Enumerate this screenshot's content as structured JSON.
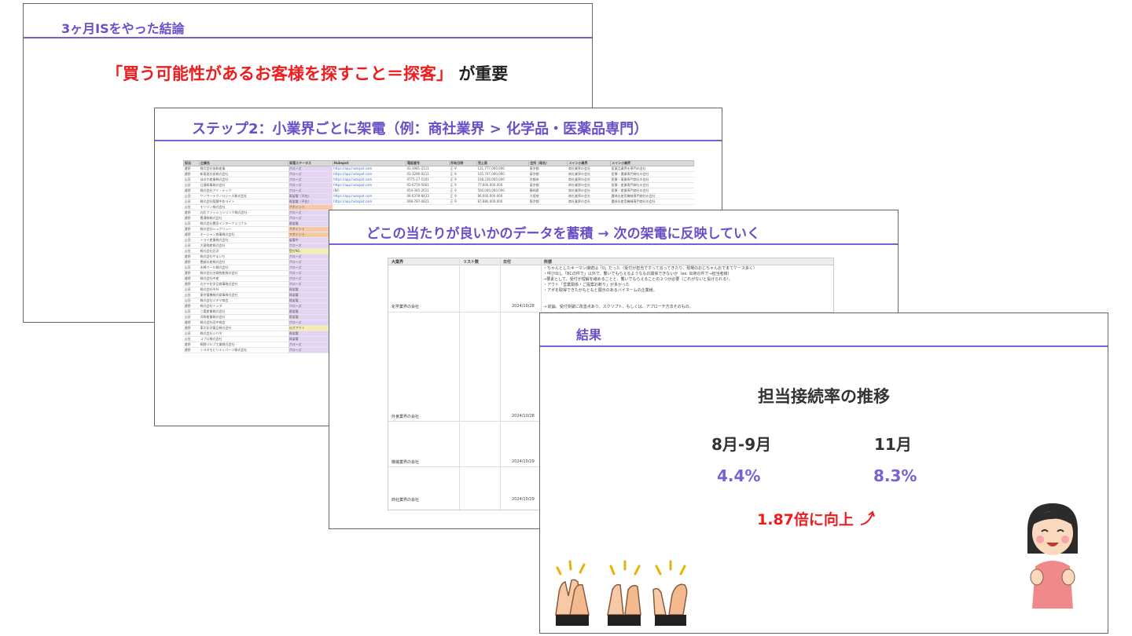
{
  "slide1": {
    "title": "3ヶ月ISをやった結論",
    "headline_red": "「買う可能性があるお客様を探すこと＝探客」",
    "headline_black": "が重要"
  },
  "slide2": {
    "title": "ステップ2：小業界ごとに架電（例：商社業界 > 化学品・医薬品専門）",
    "sheet": {
      "headers": [
        "担当",
        "企業名",
        "架電ステータス",
        "Hubspot",
        "電話番号",
        "所有日時",
        "売上高",
        "住所（県名）",
        "メイン小業界",
        "メイン小業界"
      ],
      "rows": [
        [
          "遠野",
          "株式会社協和産業",
          "クローズ",
          "https://app.hubspot.com",
          "03-3981-2111",
          "正 9",
          "131,777,000,000",
          "東京都",
          "商社業界の会社",
          "医薬品業界を専門の会社"
        ],
        [
          "遠野",
          "新東亜交易株式会社",
          "クローズ",
          "https://app.hubspot.com",
          "03-3286-0211",
          "正 9",
          "105,747,000,000",
          "東京都",
          "商社業界の会社",
          "医療・農業専門商社の会社"
        ],
        [
          "山田",
          "ほのか産業株式会社",
          "クローズ",
          "https://app.hubspot.com",
          "0775-27-5101",
          "正 9",
          "108,236,000,000",
          "京都府",
          "商社業界の会社",
          "医療・薬業専門商社の会社"
        ],
        [
          "山田",
          "日通商事株式会社",
          "クローズ",
          "https://app.hubspot.com",
          "03-6770-5661",
          "正 9",
          "77,600,000,000",
          "東京都",
          "商社業界の会社",
          "医療・産業専門商社の会社"
        ],
        [
          "遠野",
          "株式会社アイ・テック",
          "クローズ",
          "(N/)",
          "054-345-2611",
          "正 9",
          "500,040,000,000",
          "静岡県",
          "商社業界の会社",
          "医療・産業専門商社の会社"
        ],
        [
          "山田",
          "サンワーテクノロジーズ株式会社",
          "再架電（不在）",
          "https://app.hubspot.com",
          "06-6378-8433",
          "正 9",
          "86,660,000,000",
          "大阪府",
          "商社業界の会社",
          "農林水産用機械専門商社の会社"
        ],
        [
          "山田",
          "株式会社稲葉中佐ライト",
          "再架電（不在）",
          "https://app.hubspot.com",
          "048-787-0821",
          "正 9",
          "87,880,000,000",
          "東京都",
          "商社業界の会社",
          "農林水産用機械専門商社の会社"
        ],
        [
          "山田",
          "モリリン株式会社",
          "アポイント",
          "",
          "",
          "",
          "",
          "",
          "",
          ""
        ],
        [
          "遠野",
          "丸紅ファッションリンク株式会社",
          "クローズ",
          "",
          "",
          "",
          "",
          "",
          "",
          ""
        ],
        [
          "遠野",
          "豊通物株式会社",
          "クローズ",
          "",
          "",
          "",
          "",
          "",
          "",
          ""
        ],
        [
          "山田",
          "株式会社豊田インターナショナル",
          "再架電",
          "",
          "",
          "",
          "",
          "",
          "",
          ""
        ],
        [
          "遠野",
          "株式会社シュクリュー",
          "アポイント",
          "",
          "",
          "",
          "",
          "",
          "",
          ""
        ],
        [
          "遠野",
          "オーシャン商事株式会社",
          "アポイント",
          "",
          "",
          "",
          "",
          "",
          "",
          ""
        ],
        [
          "山田",
          "トライ産業株式会社",
          "架電中",
          "",
          "",
          "",
          "",
          "",
          "",
          ""
        ],
        [
          "山田",
          "大昌物産株式会社",
          "クローズ",
          "",
          "",
          "",
          "",
          "",
          "",
          ""
        ],
        [
          "山田",
          "株式会社北沢",
          "受付NG",
          "",
          "",
          "",
          "",
          "",
          "",
          ""
        ],
        [
          "遠野",
          "株式会社やまいち",
          "クローズ",
          "",
          "",
          "",
          "",
          "",
          "",
          ""
        ],
        [
          "遠野",
          "豊越水産株式会社",
          "クローズ",
          "",
          "",
          "",
          "",
          "",
          "",
          ""
        ],
        [
          "山田",
          "木綿ウール株式会社",
          "クローズ",
          "",
          "",
          "",
          "",
          "",
          "",
          ""
        ],
        [
          "遠野",
          "株式会社名商物産株式会社",
          "クローズ",
          "",
          "",
          "",
          "",
          "",
          "",
          ""
        ],
        [
          "遠野",
          "株式会社中産",
          "クローズ",
          "",
          "",
          "",
          "",
          "",
          "",
          ""
        ],
        [
          "遠野",
          "丸ヤヤ化学品商事株式会社",
          "クローズ",
          "",
          "",
          "",
          "",
          "",
          "",
          ""
        ],
        [
          "山田",
          "株式会社中外",
          "再架電",
          "",
          "",
          "",
          "",
          "",
          "",
          ""
        ],
        [
          "山田",
          "東京電機株式商事株式会社",
          "再架電",
          "",
          "",
          "",
          "",
          "",
          "",
          ""
        ],
        [
          "山田",
          "株式会社ツチヤ商会",
          "再架電",
          "",
          "",
          "",
          "",
          "",
          "",
          ""
        ],
        [
          "遠野",
          "株式会社ミシダ",
          "クローズ",
          "",
          "",
          "",
          "",
          "",
          "",
          ""
        ],
        [
          "山田",
          "三喜産業株式会社",
          "再架電",
          "",
          "",
          "",
          "",
          "",
          "",
          ""
        ],
        [
          "山田",
          "洋和産業株式会社",
          "再架電",
          "",
          "",
          "",
          "",
          "",
          "",
          ""
        ],
        [
          "遠野",
          "株式会社田中商会",
          "クローズ",
          "",
          "",
          "",
          "",
          "",
          "",
          ""
        ],
        [
          "遠野",
          "東北化学薬品株式会社",
          "ログアウト",
          "",
          "",
          "",
          "",
          "",
          "",
          ""
        ],
        [
          "山田",
          "株式会社シバタ",
          "再架電",
          "",
          "",
          "",
          "",
          "",
          "",
          ""
        ],
        [
          "山田",
          "コプロ株式会社",
          "再架電",
          "",
          "",
          "",
          "",
          "",
          "",
          ""
        ],
        [
          "遠野",
          "桐野パルプ工業株式会社",
          "クローズ",
          "",
          "",
          "",
          "",
          "",
          "",
          ""
        ],
        [
          "遠野",
          "トヨタモビリティパーツ株式会社",
          "クローズ",
          "",
          "",
          "",
          "",
          "",
          "",
          ""
        ]
      ]
    }
  },
  "slide3": {
    "title": "どこの当たりが良いかのデータを蓄積 → 次の架電に反映していく",
    "sheet": {
      "headers": [
        "大業界",
        "リスト数",
        "日付",
        "所感"
      ],
      "notes": [
        "・ちゃんとしたキーマン接続は「0」だった（受付が担当ですって言ってきたり、現場のおじちゃんおでまてケース多く）",
        "・呼び出し「BCの件で」以外で、繋いでもらえるようなもの関係できないか（ex. 出荷の件で→担当者様）",
        "→要素として、受付が理解を絡めることと、繋いでもらえることの２つが必要（これがないと投げられる）。",
        "・アウト「営業関係・ご提案お断り」が多かった",
        "・アポを取得できたがもともと展示のあるバイネームの企業様。"
      ],
      "rows": [
        {
          "category": "化学業界の会社",
          "date": "2024/10/28",
          "note": "→ 総論、受付突破に改善点あり。スクリプト、もしくは、アプローチ方法そのもの。"
        },
        {
          "category": "外食業界の会社",
          "date": "2024/10/28",
          "note": ""
        },
        {
          "category": "機械業界の会社",
          "date": "2024/10/29",
          "note": ""
        },
        {
          "category": "商社業界の会社",
          "date": "2024/10/29",
          "note": ""
        }
      ]
    }
  },
  "slide4": {
    "title": "結果",
    "subtitle": "担当接続率の推移",
    "period1": "8月-9月",
    "period2": "11月",
    "value1": "4.4%",
    "value2": "8.3%",
    "improvement": "1.87倍に向上",
    "colors": {
      "accent": "#7a5fd6",
      "emphasis": "#ee1c1c"
    },
    "icons": [
      "clapping-hands-icon",
      "smiling-woman-icon",
      "upward-arrow-icon"
    ]
  }
}
